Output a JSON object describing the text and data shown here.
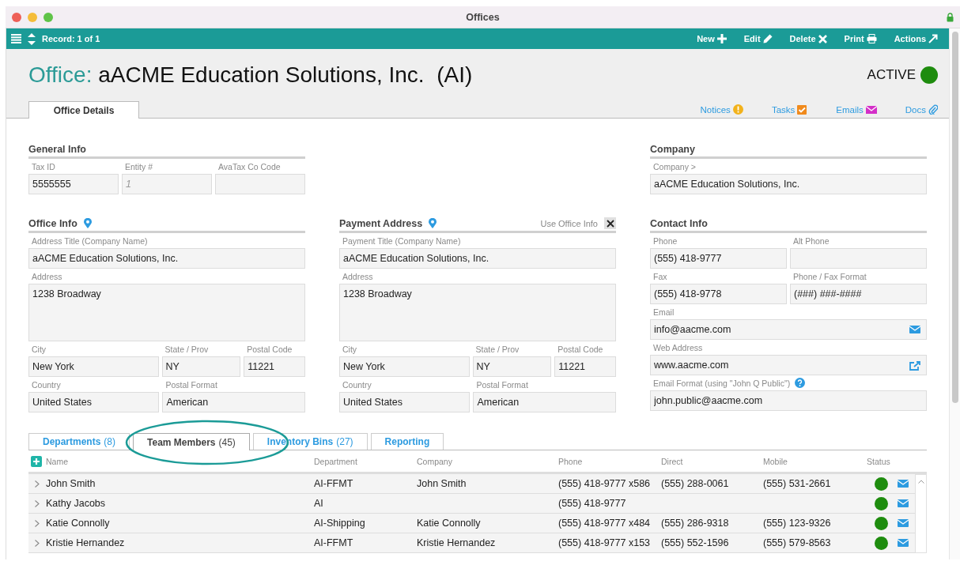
{
  "window": {
    "title": "Offices"
  },
  "toolbar": {
    "record": "Record: 1 of 1",
    "actions": [
      {
        "label": "New",
        "kind": "new"
      },
      {
        "label": "Edit",
        "kind": "edit"
      },
      {
        "label": "Delete",
        "kind": "delete"
      },
      {
        "label": "Print",
        "kind": "print"
      },
      {
        "label": "Actions",
        "kind": "actions"
      }
    ]
  },
  "header": {
    "prefix": "Office:",
    "name": "aACME Education Solutions, Inc.  (AI)",
    "status": "ACTIVE"
  },
  "tabs": [
    {
      "label": "Office Details",
      "selected": true
    }
  ],
  "links": [
    {
      "label": "Notices",
      "kind": "notices"
    },
    {
      "label": "Tasks",
      "kind": "tasks"
    },
    {
      "label": "Emails",
      "kind": "emails"
    },
    {
      "label": "Docs",
      "kind": "docs"
    }
  ],
  "form": {
    "section_rows": [
      [
        {
          "title": "General Info",
          "kind": "general",
          "rows": [
            [
              {
                "label": "Tax ID",
                "value": "5555555",
                "kind": "text"
              },
              {
                "label": "Entity #",
                "placeholder": "1",
                "kind": "text"
              },
              {
                "label": "AvaTax Co Code",
                "kind": "text"
              }
            ]
          ]
        },
        {
          "title": "Company",
          "kind": "company",
          "rows": [
            [
              {
                "label": "Company >",
                "value": "aACME Education Solutions, Inc.",
                "kind": "text"
              }
            ]
          ]
        }
      ],
      [
        {
          "title": "Office Info",
          "kind": "address",
          "rows": [
            [
              {
                "label": "Address Title (Company Name)",
                "value": "aACME Education Solutions, Inc.",
                "kind": "text"
              }
            ],
            [
              {
                "label": "Address",
                "value": "1238 Broadway",
                "kind": "textarea"
              }
            ],
            [
              {
                "label": "City",
                "value": "New York",
                "kind": "text"
              },
              {
                "label": "State / Prov",
                "value": "NY",
                "kind": "text"
              },
              {
                "label": "Postal Code",
                "value": "11221",
                "kind": "text"
              }
            ],
            [
              {
                "label": "Country",
                "value": "United States",
                "kind": "text"
              },
              {
                "label": "Postal Format",
                "value": "American",
                "kind": "text"
              }
            ]
          ]
        },
        {
          "title": "Payment Address",
          "kind": "address",
          "option": {
            "label": "Use Office Info",
            "checked": true
          },
          "rows": [
            [
              {
                "label": "Payment Title (Company Name)",
                "value": "aACME Education Solutions, Inc.",
                "kind": "text"
              }
            ],
            [
              {
                "label": "Address",
                "value": "1238 Broadway",
                "kind": "textarea"
              }
            ],
            [
              {
                "label": "City",
                "value": "New York",
                "kind": "text"
              },
              {
                "label": "State / Prov",
                "value": "NY",
                "kind": "text"
              },
              {
                "label": "Postal Code",
                "value": "11221",
                "kind": "text"
              }
            ],
            [
              {
                "label": "Country",
                "value": "United States",
                "kind": "text"
              },
              {
                "label": "Postal Format",
                "value": "American",
                "kind": "text"
              }
            ]
          ]
        },
        {
          "title": "Contact Info",
          "kind": "contact",
          "rows": [
            [
              {
                "label": "Phone",
                "value": "(555) 418-9777",
                "kind": "text"
              },
              {
                "label": "Alt Phone",
                "kind": "text"
              }
            ],
            [
              {
                "label": "Fax",
                "value": "(555) 418-9778",
                "kind": "text"
              },
              {
                "label": "Phone / Fax Format",
                "value": "(###) ###-####",
                "kind": "text"
              }
            ],
            [
              {
                "label": "Email",
                "value": "info@aacme.com",
                "kind": "email"
              }
            ],
            [
              {
                "label": "Web Address",
                "value": "www.aacme.com",
                "kind": "link"
              }
            ],
            [
              {
                "label": "Email Format (using \"John Q Public\")",
                "value": "john.public@aacme.com",
                "kind": "help"
              }
            ]
          ]
        }
      ]
    ]
  },
  "subtabs": [
    {
      "label": "Departments",
      "count": "(8)",
      "selected": false
    },
    {
      "label": "Team Members",
      "count": "(45)",
      "selected": true
    },
    {
      "label": "Inventory Bins",
      "count": "(27)",
      "selected": false
    },
    {
      "label": "Reporting",
      "selected": false
    }
  ],
  "table": {
    "columns": [
      "Name",
      "Department",
      "Company",
      "Phone",
      "Direct",
      "Mobile",
      "Status"
    ],
    "rows": [
      {
        "name": "John Smith",
        "department": "AI-FFMT",
        "company": "John Smith",
        "phone": "(555) 418-9777 x586",
        "direct": "(555) 288-0061",
        "mobile": "(555) 531-2661",
        "color": "#1e8c0e"
      },
      {
        "name": "Kathy Jacobs",
        "department": "AI",
        "phone": "(555) 418-9777",
        "color": "#1e8c0e"
      },
      {
        "name": "Katie Connolly",
        "department": "AI-Shipping",
        "company": "Katie Connolly",
        "phone": "(555) 418-9777 x484",
        "direct": "(555) 286-9318",
        "mobile": "(555) 123-9326",
        "color": "#1e8c0e"
      },
      {
        "name": "Kristie Hernandez",
        "department": "AI-FFMT",
        "company": "Kristie Hernandez",
        "phone": "(555) 418-9777 x153",
        "direct": "(555) 552-1596",
        "mobile": "(555) 579-8563",
        "color": "#1e8c0e"
      }
    ]
  }
}
